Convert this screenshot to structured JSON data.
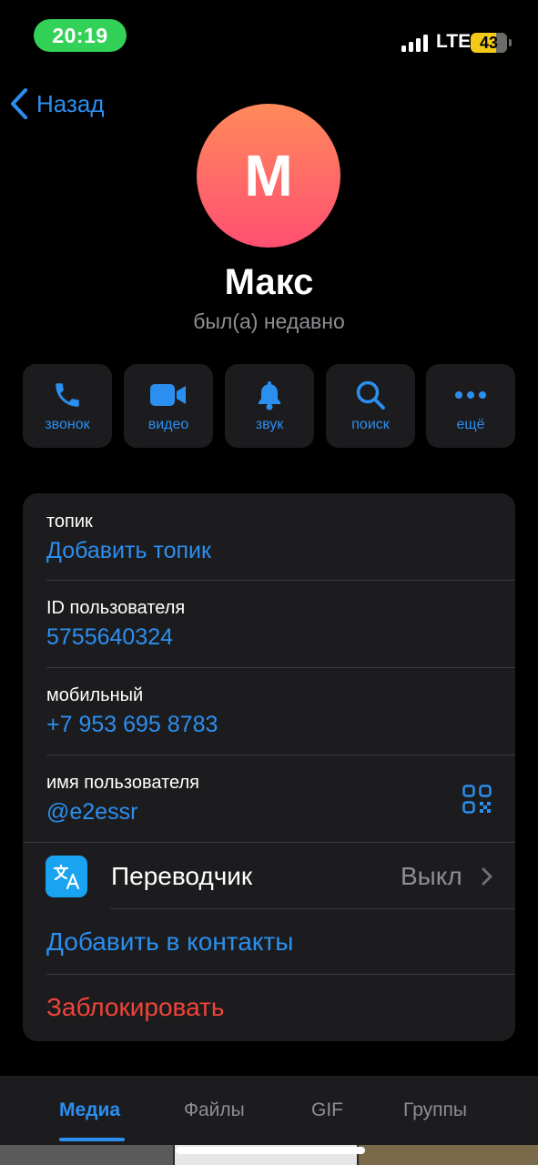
{
  "status_bar": {
    "time": "20:19",
    "network": "LTE",
    "battery": "43"
  },
  "nav": {
    "back_label": "Назад"
  },
  "profile": {
    "avatar_letter": "М",
    "name": "Макс",
    "status": "был(а) недавно"
  },
  "actions": [
    {
      "icon": "phone-icon",
      "label": "звонок"
    },
    {
      "icon": "video-icon",
      "label": "видео"
    },
    {
      "icon": "bell-icon",
      "label": "звук"
    },
    {
      "icon": "search-icon",
      "label": "поиск"
    },
    {
      "icon": "more-icon",
      "label": "ещё"
    }
  ],
  "info": {
    "topic": {
      "label": "топик",
      "value": "Добавить топик"
    },
    "user_id": {
      "label": "ID пользователя",
      "value": "5755640324"
    },
    "mobile": {
      "label": "мобильный",
      "value": "+7 953 695 8783"
    },
    "username": {
      "label": "имя пользователя",
      "value": "@e2essr"
    },
    "translator": {
      "label": "Переводчик",
      "value": "Выкл"
    },
    "add_contact": "Добавить в контакты",
    "block": "Заблокировать"
  },
  "tabs": [
    {
      "label": "Медиа",
      "active": true
    },
    {
      "label": "Файлы",
      "active": false
    },
    {
      "label": "GIF",
      "active": false
    },
    {
      "label": "Группы",
      "active": false
    }
  ],
  "colors": {
    "accent": "#2b8ff0",
    "danger": "#f0443a",
    "card": "#1c1c1e",
    "status_pill": "#33d157",
    "battery": "#f5c91a"
  }
}
